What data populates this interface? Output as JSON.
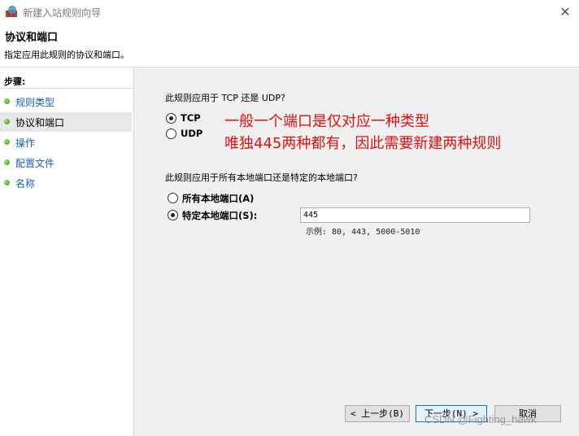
{
  "window": {
    "title": "新建入站规则向导",
    "close_glyph": "✕"
  },
  "header": {
    "title": "协议和端口",
    "description": "指定应用此规则的协议和端口。"
  },
  "sidebar": {
    "steps_label": "步骤:",
    "items": [
      {
        "label": "规则类型",
        "state": "link"
      },
      {
        "label": "协议和端口",
        "state": "current"
      },
      {
        "label": "操作",
        "state": "link"
      },
      {
        "label": "配置文件",
        "state": "link"
      },
      {
        "label": "名称",
        "state": "link"
      }
    ]
  },
  "main": {
    "protocol_question": "此规则应用于 TCP 还是 UDP?",
    "protocol_options": [
      {
        "label": "TCP",
        "checked": true
      },
      {
        "label": "UDP",
        "checked": false
      }
    ],
    "port_question": "此规则应用于所有本地端口还是特定的本地端口?",
    "port_options": [
      {
        "label": "所有本地端口(A)",
        "checked": false
      },
      {
        "label": "特定本地端口(S):",
        "checked": true
      }
    ],
    "ports_value": "445",
    "ports_example": "示例: 80, 443, 5000-5010"
  },
  "annotation": {
    "line1": "一般一个端口是仅对应一种类型",
    "line2": "唯独445两种都有，因此需要新建两种规则",
    "color": "#e01010"
  },
  "buttons": {
    "back": "< 上一步(B)",
    "next": "下一步(N) >",
    "cancel": "取消"
  },
  "watermark": "CSDN @Fighting_hawk"
}
